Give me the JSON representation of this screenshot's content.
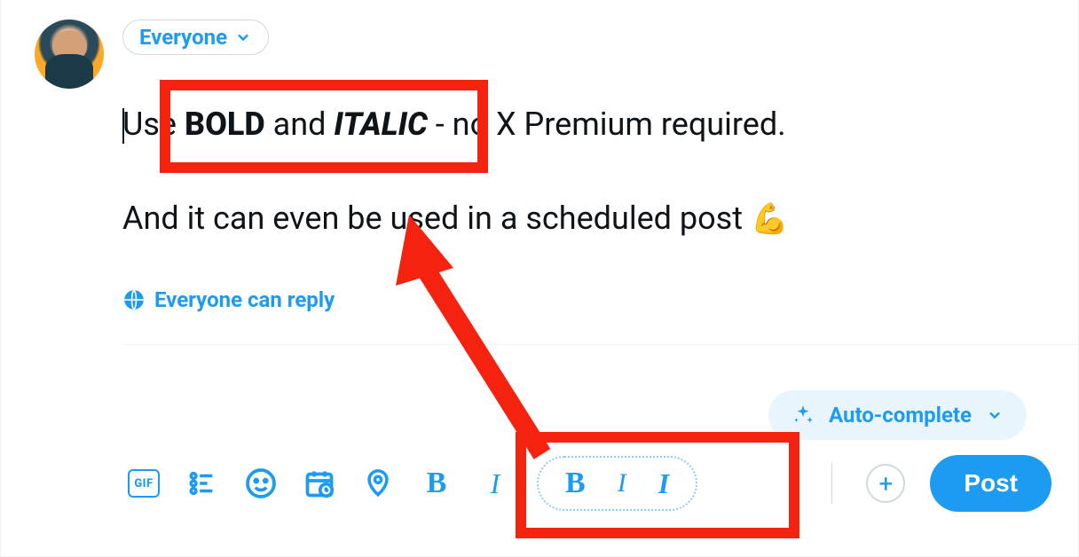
{
  "audience": {
    "label": "Everyone"
  },
  "compose": {
    "prefix": "Use ",
    "bold_word": "BOLD",
    "mid1": " and ",
    "italic_word": "ITALIC",
    "mid2": " - no X Premium required.",
    "line2": "And it can even be used in a scheduled post ",
    "emoji": "💪"
  },
  "reply": {
    "label": "Everyone can reply"
  },
  "autocomplete": {
    "label": "Auto-complete"
  },
  "toolbar": {
    "gif_label": "GIF",
    "bold_glyph": "B",
    "italic_glyph": "I",
    "post_label": "Post",
    "plus_glyph": "+"
  },
  "popup": {
    "bold": "B",
    "italic": "I",
    "bold_italic": "I"
  },
  "colors": {
    "accent": "#1d9bf0",
    "highlight": "#f4220e"
  }
}
